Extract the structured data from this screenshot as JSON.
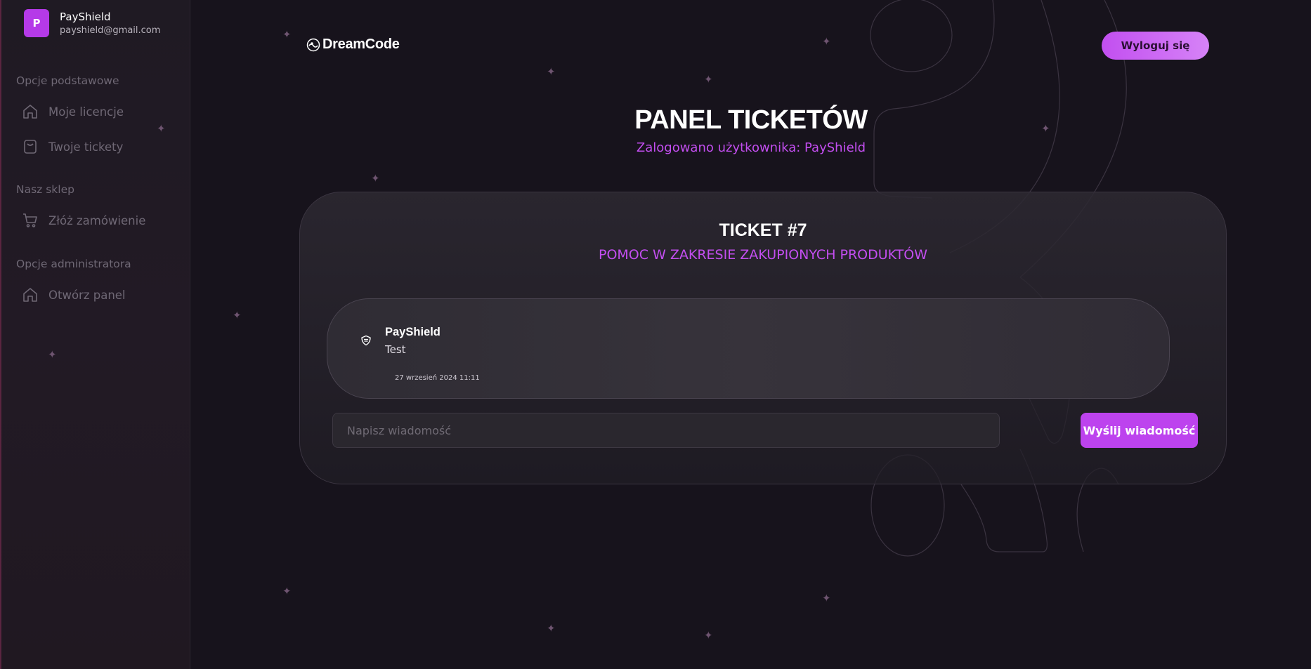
{
  "sidebar": {
    "profile": {
      "avatar_letter": "P",
      "name": "PayShield",
      "email": "payshield@gmail.com"
    },
    "sections": [
      {
        "title": "Opcje podstawowe",
        "items": [
          {
            "label": "Moje licencje",
            "icon": "home-icon"
          },
          {
            "label": "Twoje tickety",
            "icon": "bag-icon"
          }
        ]
      },
      {
        "title": "Nasz sklep",
        "items": [
          {
            "label": "Złóż zamówienie",
            "icon": "cart-icon"
          }
        ]
      },
      {
        "title": "Opcje administratora",
        "items": [
          {
            "label": "Otwórz panel",
            "icon": "home-icon"
          }
        ]
      }
    ]
  },
  "header": {
    "logo_text": "DreamCode",
    "logout_label": "Wyloguj się"
  },
  "page": {
    "title": "PANEL TICKETÓW",
    "subtitle": "Zalogowano użytkownika: PayShield"
  },
  "ticket": {
    "title": "TICKET #7",
    "category": "POMOC W ZAKRESIE ZAKUPIONYCH PRODUKTÓW",
    "messages": [
      {
        "author": "PayShield",
        "text": "Test",
        "date": "27 wrzesień 2024 11:11",
        "icon": "shield-icon"
      }
    ],
    "input_placeholder": "Napisz wiadomość",
    "send_label": "Wyślij wiadomość"
  },
  "colors": {
    "accent": "#c34ef0",
    "background": "#17131c",
    "sidebar": "#1f1a23"
  }
}
